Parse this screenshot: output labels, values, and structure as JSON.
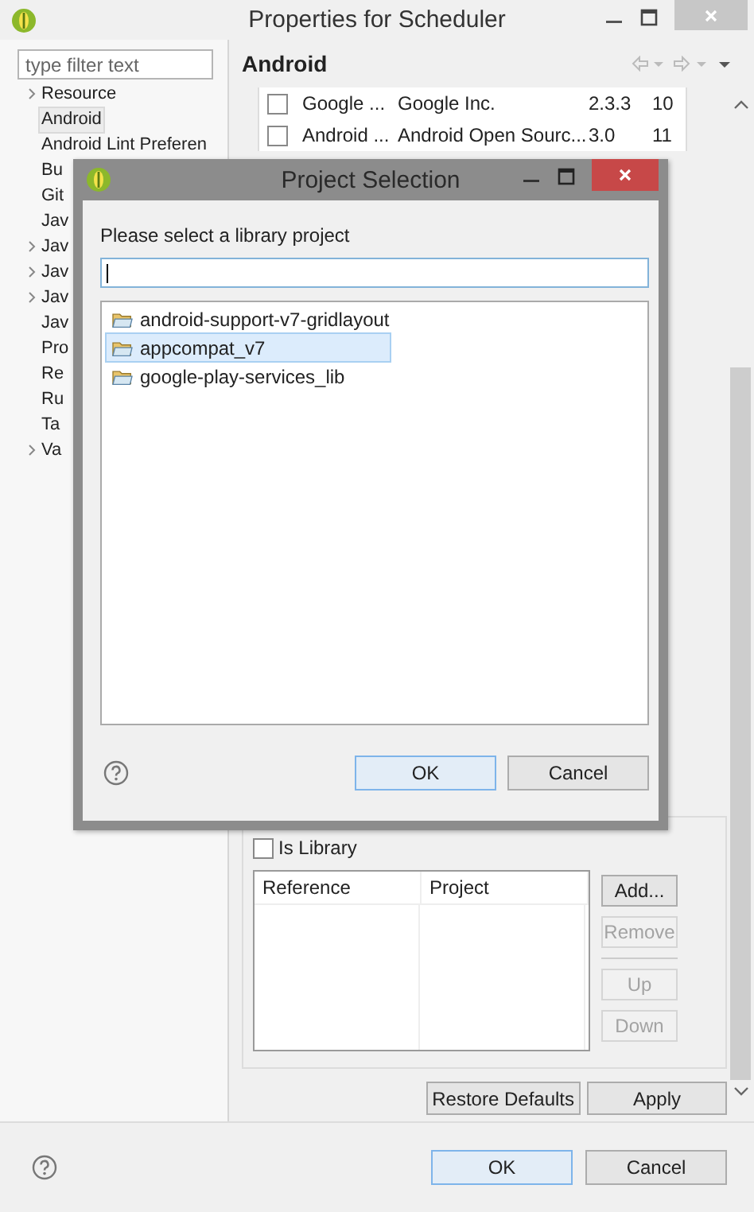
{
  "window": {
    "title": "Properties for Scheduler"
  },
  "sidebar": {
    "filter": {
      "placeholder": "type filter text"
    },
    "items": [
      {
        "label": "Resource",
        "expandable": true,
        "selected": false
      },
      {
        "label": "Android",
        "expandable": false,
        "selected": true
      },
      {
        "label": "Android Lint Preferen",
        "expandable": false,
        "selected": false
      },
      {
        "label": "Bu",
        "expandable": false,
        "selected": false
      },
      {
        "label": "Git",
        "expandable": false,
        "selected": false
      },
      {
        "label": "Jav",
        "expandable": false,
        "selected": false
      },
      {
        "label": "Jav",
        "expandable": true,
        "selected": false
      },
      {
        "label": "Jav",
        "expandable": true,
        "selected": false
      },
      {
        "label": "Jav",
        "expandable": true,
        "selected": false
      },
      {
        "label": "Jav",
        "expandable": false,
        "selected": false
      },
      {
        "label": "Pro",
        "expandable": false,
        "selected": false
      },
      {
        "label": "Re",
        "expandable": false,
        "selected": false
      },
      {
        "label": "Ru",
        "expandable": false,
        "selected": false
      },
      {
        "label": "Ta",
        "expandable": false,
        "selected": false
      },
      {
        "label": "Va",
        "expandable": true,
        "selected": false
      }
    ]
  },
  "panel": {
    "title": "Android",
    "targets": [
      {
        "checked": false,
        "cells": [
          "Google ...",
          "Google Inc.",
          "2.3.3",
          "10"
        ]
      },
      {
        "checked": false,
        "cells": [
          "Android ...",
          "Android Open Sourc...",
          "3.0",
          "11"
        ]
      }
    ],
    "is_library": {
      "label": "Is Library",
      "checked": false
    },
    "references": {
      "columns": [
        "Reference",
        "Project"
      ]
    },
    "side_buttons": [
      {
        "label": "Add...",
        "disabled": false
      },
      {
        "label": "Remove",
        "disabled": true
      },
      {
        "label": "Up",
        "disabled": true
      },
      {
        "label": "Down",
        "disabled": true
      }
    ],
    "actions": [
      "Restore Defaults",
      "Apply"
    ]
  },
  "buttons": [
    "OK",
    "Cancel"
  ],
  "dialog": {
    "title": "Project Selection",
    "prompt": "Please select a library project",
    "projects": [
      {
        "name": "android-support-v7-gridlayout",
        "selected": false
      },
      {
        "name": "appcompat_v7",
        "selected": true
      },
      {
        "name": "google-play-services_lib",
        "selected": false
      }
    ],
    "buttons": [
      "OK",
      "Cancel"
    ]
  }
}
